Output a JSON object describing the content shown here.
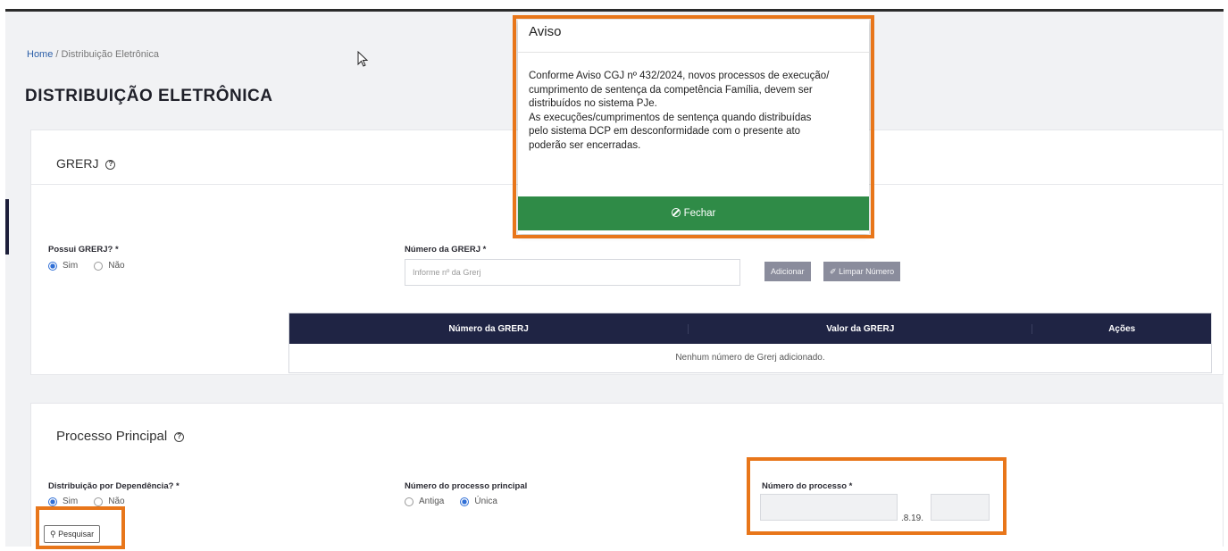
{
  "breadcrumb": {
    "home": "Home",
    "separator": " / ",
    "current": "Distribuição Eletrônica"
  },
  "page_title": "DISTRIBUIÇÃO ELETRÔNICA",
  "grerj": {
    "title": "GRERJ",
    "possui_label": "Possui GRERJ? *",
    "options": [
      "Sim",
      "Não"
    ],
    "selected": "Sim",
    "numero_label": "Número da GRERJ *",
    "numero_placeholder": "Informe nº da Grerj",
    "add_button": "Adicionar",
    "clear_button": "Limpar Número",
    "table": {
      "headers": [
        "Número da GRERJ",
        "Valor da GRERJ",
        "Ações"
      ],
      "empty": "Nenhum número de Grerj adicionado."
    }
  },
  "processo": {
    "title": "Processo Principal",
    "dependencia_label": "Distribuição por Dependência? *",
    "dependencia_options": [
      "Sim",
      "Não"
    ],
    "dependencia_selected": "Sim",
    "principal_label": "Número do processo principal",
    "principal_options": [
      "Antiga",
      "Única"
    ],
    "principal_selected": "Única",
    "numero_label": "Número do processo *",
    "numero_separator": ".8.19.",
    "search_button": "Pesquisar"
  },
  "modal": {
    "title": "Aviso",
    "lines": [
      "Conforme Aviso CGJ nº 432/2024, novos processos de execução/",
      "cumprimento de sentença da competência Família, devem ser",
      "distribuídos no sistema PJe.",
      "As execuções/cumprimentos de sentença quando distribuídas",
      "pelo sistema DCP em desconformidade com o presente ato",
      "poderão ser encerradas."
    ],
    "close_button": "Fechar"
  },
  "colors": {
    "highlight": "#e8761a",
    "primary_dark": "#1f2444",
    "success": "#2f8b47",
    "radio": "#2f6fd6"
  }
}
